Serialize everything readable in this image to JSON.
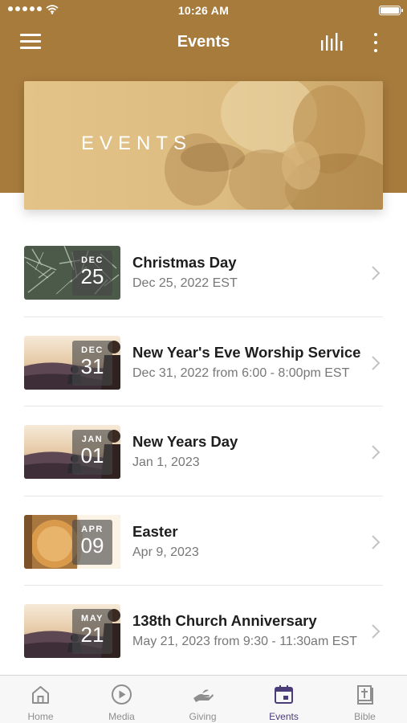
{
  "status_bar": {
    "time": "10:26 AM"
  },
  "nav": {
    "title": "Events",
    "menu_icon": "hamburger-menu-icon",
    "stats_icon": "bar-stats-icon",
    "more_icon": "more-vertical-icon"
  },
  "banner": {
    "title": "EVENTS"
  },
  "colors": {
    "header": "#a77b3c",
    "active_tab": "#4a3d7a",
    "inactive_tab": "#8e8e8e"
  },
  "events": [
    {
      "month": "DEC",
      "day": "25",
      "title": "Christmas Day",
      "subtitle": "Dec 25, 2022 EST",
      "image": "pine-branches"
    },
    {
      "month": "DEC",
      "day": "31",
      "title": "New Year's Eve Worship Service",
      "subtitle": "Dec 31, 2022 from 6:00 - 8:00pm EST",
      "image": "sunset-person"
    },
    {
      "month": "JAN",
      "day": "01",
      "title": "New Years Day",
      "subtitle": "Jan 1, 2023",
      "image": "sunset-person"
    },
    {
      "month": "APR",
      "day": "09",
      "title": "Easter",
      "subtitle": "Apr 9, 2023",
      "image": "empty-tomb"
    },
    {
      "month": "MAY",
      "day": "21",
      "title": "138th Church Anniversary",
      "subtitle": "May 21, 2023 from 9:30 - 11:30am EST",
      "image": "sunset-person"
    }
  ],
  "tabs": [
    {
      "label": "Home",
      "icon": "home-icon",
      "active": false
    },
    {
      "label": "Media",
      "icon": "play-circle-icon",
      "active": false
    },
    {
      "label": "Giving",
      "icon": "giving-hand-icon",
      "active": false
    },
    {
      "label": "Events",
      "icon": "calendar-icon",
      "active": true
    },
    {
      "label": "Bible",
      "icon": "bible-icon",
      "active": false
    }
  ]
}
